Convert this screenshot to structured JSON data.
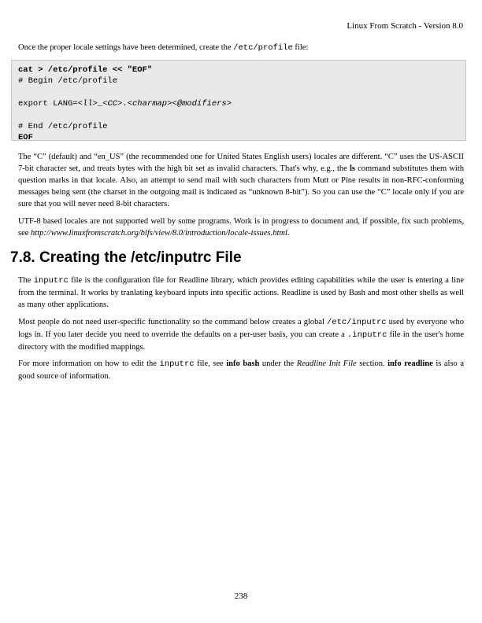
{
  "header": {
    "title": "Linux From Scratch - Version 8.0"
  },
  "intro": {
    "pre": "Once the proper locale settings have been determined, create the ",
    "file": "/etc/profile",
    "post": " file:"
  },
  "code": {
    "l1": "cat > /etc/profile << \"EOF\"",
    "l2": "# Begin /etc/profile",
    "l4_pre": "export LANG=",
    "l4_ll": "<ll>",
    "l4_sep1": "_",
    "l4_cc": "<CC>",
    "l4_dot": ".",
    "l4_charmap": "<charmap>",
    "l4_mod": "<@modifiers>",
    "l6": "# End /etc/profile",
    "l7": "EOF"
  },
  "para1": {
    "a": "The “C” (default) and “en_US” (the recommended one for United States English users) locales are different. “C” uses the US-ASCII 7-bit character set, and treats bytes with the high bit set as invalid characters. That's why, e.g., the ",
    "ls": "ls",
    "b": " command substitutes them with question marks in that locale. Also, an attempt to send mail with such characters from Mutt or Pine results in non-RFC-conforming messages being sent (the charset in the outgoing mail is indicated as “unknown 8-bit”). So you can use the “C” locale only if you are sure that you will never need 8-bit characters."
  },
  "para2": {
    "a": "UTF-8 based locales are not supported well by some programs. Work is in progress to document and, if possible, fix such problems, see ",
    "link": "http://www.linuxfromscratch.org/blfs/view/8.0/introduction/locale-issues.html",
    "b": "."
  },
  "section": {
    "heading": "7.8. Creating the /etc/inputrc File"
  },
  "para3": {
    "pre": "The ",
    "file": "inputrc",
    "post": " file is the configuration file for Readline library, which provides editing capabilities while the user is entering a line from the terminal. It works by tranlating keyboard inputs into specific actions. Readline is used by Bash and most other shells as well as many other applications."
  },
  "para4": {
    "a": "Most people do not need user-specific functionality so the command below creates a global ",
    "file1": "/etc/inputrc",
    "b": " used by everyone who logs in. If you later decide you need to override the defaults on a per-user basis, you can create a ",
    "file2": ".inputrc",
    "c": " file in the user's home directory with the modified mappings."
  },
  "para5": {
    "a": "For more information on how to edit the ",
    "file": "inputrc",
    "b": " file, see ",
    "cmd1": "info bash",
    "c": " under the ",
    "section": "Readline Init File",
    "d": " section. ",
    "cmd2": "info readline",
    "e": " is also a good source of information."
  },
  "footer": {
    "page_number": "238"
  }
}
